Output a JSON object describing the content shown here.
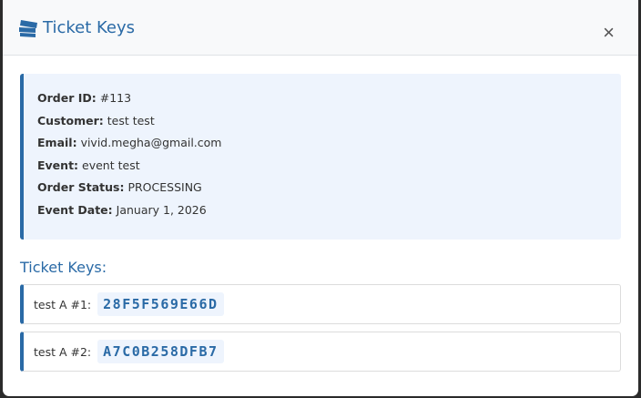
{
  "modal": {
    "title": "Ticket Keys",
    "close_label": "×"
  },
  "order": {
    "rows": [
      {
        "label": "Order ID:",
        "value": "#113"
      },
      {
        "label": "Customer:",
        "value": "test test"
      },
      {
        "label": "Email:",
        "value": "vivid.megha@gmail.com"
      },
      {
        "label": "Event:",
        "value": "event test"
      },
      {
        "label": "Order Status:",
        "value": "PROCESSING"
      },
      {
        "label": "Event Date:",
        "value": "January 1, 2026"
      }
    ]
  },
  "keys": {
    "heading": "Ticket Keys:",
    "items": [
      {
        "label": "test A #1:",
        "code": "28F5F569E66D"
      },
      {
        "label": "test A #2:",
        "code": "A7C0B258DFB7"
      }
    ]
  },
  "colors": {
    "accent": "#2a6aa6",
    "panel": "#eef4fd"
  }
}
